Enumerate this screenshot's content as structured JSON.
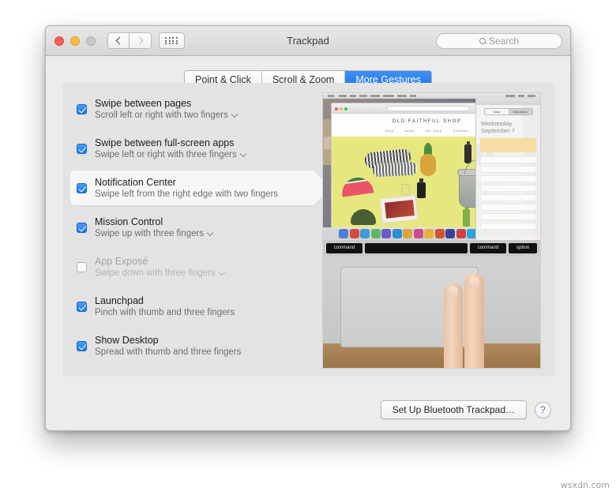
{
  "window": {
    "title": "Trackpad",
    "traffic_lights": [
      "close",
      "minimize",
      "zoom"
    ],
    "nav": {
      "back": "back-chevron",
      "forward": "forward-chevron",
      "grid": "show-all-grid"
    },
    "search": {
      "placeholder": "Search",
      "icon": "search-icon"
    }
  },
  "tabs": [
    {
      "label": "Point & Click",
      "active": false
    },
    {
      "label": "Scroll & Zoom",
      "active": false
    },
    {
      "label": "More Gestures",
      "active": true
    }
  ],
  "gestures": [
    {
      "title": "Swipe between pages",
      "subtitle": "Scroll left or right with two fingers",
      "checked": true,
      "enabled": true,
      "has_dropdown": true,
      "selected": false
    },
    {
      "title": "Swipe between full-screen apps",
      "subtitle": "Swipe left or right with three fingers",
      "checked": true,
      "enabled": true,
      "has_dropdown": true,
      "selected": false
    },
    {
      "title": "Notification Center",
      "subtitle": "Swipe left from the right edge with two fingers",
      "checked": true,
      "enabled": true,
      "has_dropdown": false,
      "selected": true
    },
    {
      "title": "Mission Control",
      "subtitle": "Swipe up with three fingers",
      "checked": true,
      "enabled": true,
      "has_dropdown": true,
      "selected": false
    },
    {
      "title": "App Exposé",
      "subtitle": "Swipe down with three fingers",
      "checked": false,
      "enabled": false,
      "has_dropdown": true,
      "selected": false
    },
    {
      "title": "Launchpad",
      "subtitle": "Pinch with thumb and three fingers",
      "checked": true,
      "enabled": true,
      "has_dropdown": false,
      "selected": false
    },
    {
      "title": "Show Desktop",
      "subtitle": "Spread with thumb and three fingers",
      "checked": true,
      "enabled": true,
      "has_dropdown": false,
      "selected": false
    }
  ],
  "preview": {
    "shop_title": "OLD FAITHFUL SHOP",
    "shop_nav": [
      "Shop",
      "About",
      "Our Story",
      "Stockists"
    ],
    "notification_center": {
      "segments": [
        "Today",
        "Notifications"
      ],
      "selected_segment": "Notifications",
      "date_line1": "Wednesday",
      "date_line2": "September 7"
    },
    "keys": [
      "command",
      "",
      "command",
      "option"
    ]
  },
  "footer": {
    "setup_button": "Set Up Bluetooth Trackpad…",
    "help_button": "?"
  },
  "watermark": "wsxdn.com",
  "colors": {
    "accent_blue": "#1d72e8",
    "checkbox_blue": "#1e7ae8",
    "window_bg": "#ececec",
    "panel_bg": "#e3e3e3"
  }
}
